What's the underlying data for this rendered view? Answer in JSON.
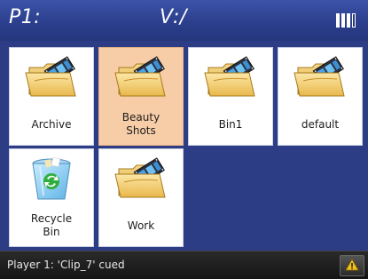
{
  "header": {
    "player_label": "P1:",
    "volume_label": "V:/",
    "battery_icon": "battery-icon"
  },
  "folders": [
    {
      "label": "Archive",
      "icon": "folder-icon",
      "selected": false
    },
    {
      "label": "Beauty Shots",
      "icon": "folder-icon",
      "selected": true
    },
    {
      "label": "Bin1",
      "icon": "folder-icon",
      "selected": false
    },
    {
      "label": "default",
      "icon": "folder-icon",
      "selected": false
    },
    {
      "label": "Recycle Bin",
      "icon": "recycle-bin-icon",
      "selected": false
    },
    {
      "label": "Work",
      "icon": "folder-icon",
      "selected": false
    }
  ],
  "status": {
    "message": "Player 1: 'Clip_7' cued",
    "warning_icon": "warning-icon"
  },
  "colors": {
    "header": "#2c3f8d",
    "background": "#2c3d86",
    "selected_tile": "#f7cda7",
    "status_bar": "#1e1e1e"
  }
}
